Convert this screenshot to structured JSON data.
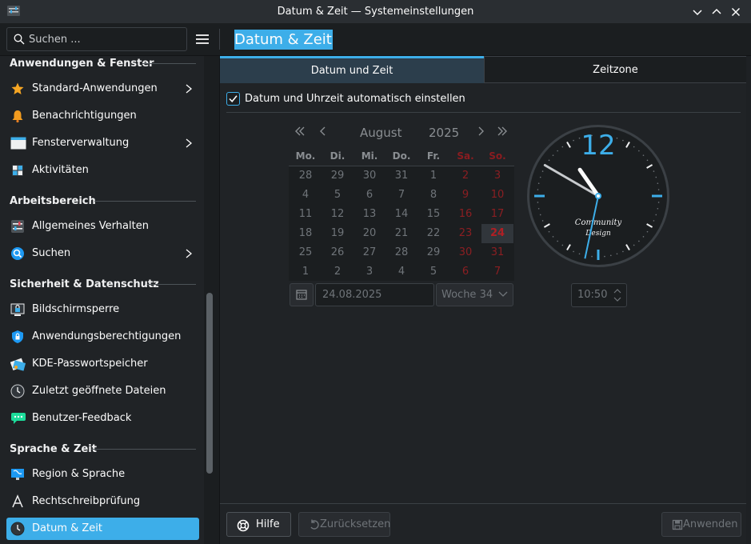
{
  "window": {
    "title": "Datum & Zeit — Systemeinstellungen"
  },
  "search": {
    "placeholder": "Suchen ..."
  },
  "page_title": "Datum & Zeit",
  "sidebar": {
    "groups": [
      {
        "label": "Anwendungen & Fenster"
      },
      {
        "label": "Arbeitsbereich"
      },
      {
        "label": "Sicherheit & Datenschutz"
      },
      {
        "label": "Sprache & Zeit"
      }
    ],
    "items": [
      {
        "label": "Standard-Anwendungen",
        "icon": "star-icon",
        "has_children": true
      },
      {
        "label": "Benachrichtigungen",
        "icon": "bell-icon"
      },
      {
        "label": "Fensterverwaltung",
        "icon": "window-icon",
        "has_children": true
      },
      {
        "label": "Aktivitäten",
        "icon": "activities-icon"
      },
      {
        "label": "Allgemeines Verhalten",
        "icon": "behavior-icon"
      },
      {
        "label": "Suchen",
        "icon": "search-icon",
        "has_children": true
      },
      {
        "label": "Bildschirmsperre",
        "icon": "lock-screen-icon"
      },
      {
        "label": "Anwendungsberechtigungen",
        "icon": "shield-icon"
      },
      {
        "label": "KDE-Passwortspeicher",
        "icon": "wallet-icon"
      },
      {
        "label": "Zuletzt geöffnete Dateien",
        "icon": "clock-icon"
      },
      {
        "label": "Benutzer-Feedback",
        "icon": "feedback-icon"
      },
      {
        "label": "Region & Sprache",
        "icon": "region-icon"
      },
      {
        "label": "Rechtschreibprüfung",
        "icon": "spellcheck-icon"
      },
      {
        "label": "Datum & Zeit",
        "icon": "clock-icon",
        "active": true
      }
    ]
  },
  "tabs": [
    {
      "label": "Datum und Zeit",
      "active": true
    },
    {
      "label": "Zeitzone",
      "active": false
    }
  ],
  "auto_set": {
    "label": "Datum und Uhrzeit automatisch einstellen",
    "checked": true
  },
  "calendar": {
    "month": "August",
    "year": "2025",
    "weekdays": [
      "Mo.",
      "Di.",
      "Mi.",
      "Do.",
      "Fr.",
      "Sa.",
      "So."
    ],
    "weeks": [
      [
        "28",
        "29",
        "30",
        "31",
        "1",
        "2",
        "3"
      ],
      [
        "4",
        "5",
        "6",
        "7",
        "8",
        "9",
        "10"
      ],
      [
        "11",
        "12",
        "13",
        "14",
        "15",
        "16",
        "17"
      ],
      [
        "18",
        "19",
        "20",
        "21",
        "22",
        "23",
        "24"
      ],
      [
        "25",
        "26",
        "27",
        "28",
        "29",
        "30",
        "31"
      ],
      [
        "1",
        "2",
        "3",
        "4",
        "5",
        "6",
        "7"
      ]
    ],
    "selected_day": "24",
    "date_value": "24.08.2025",
    "week_value": "Woche 34"
  },
  "clock": {
    "numeral": "12",
    "brand_line1": "Community",
    "brand_line2": "Design",
    "time_value": "10:50",
    "hour": 10,
    "minute": 50
  },
  "buttons": {
    "help": "Hilfe",
    "reset": "Zurücksetzen",
    "apply": "Anwenden"
  },
  "colors": {
    "accent": "#3daee9",
    "weekend": "#8b1e22",
    "background": "#202326"
  }
}
